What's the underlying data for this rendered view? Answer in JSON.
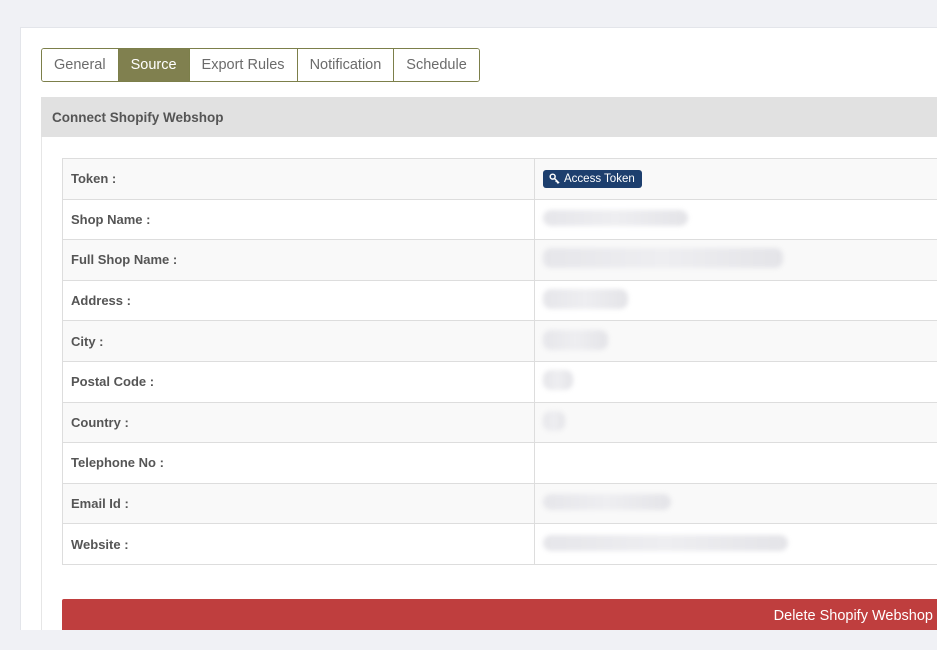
{
  "tabs": [
    {
      "label": "General",
      "active": false
    },
    {
      "label": "Source",
      "active": true
    },
    {
      "label": "Export Rules",
      "active": false
    },
    {
      "label": "Notification",
      "active": false
    },
    {
      "label": "Schedule",
      "active": false
    }
  ],
  "panel": {
    "title": "Connect Shopify Webshop"
  },
  "fields": [
    {
      "label": "Token :",
      "button": "Access Token"
    },
    {
      "label": "Shop Name :"
    },
    {
      "label": "Full Shop Name :"
    },
    {
      "label": "Address :"
    },
    {
      "label": "City :"
    },
    {
      "label": "Postal Code :"
    },
    {
      "label": "Country :"
    },
    {
      "label": "Telephone No :"
    },
    {
      "label": "Email Id :"
    },
    {
      "label": "Website :"
    }
  ],
  "delete_button": "Delete Shopify Webshop",
  "colors": {
    "tab_active": "#80804f",
    "token_button": "#1d3f6e",
    "delete_button": "#bf3e3e"
  }
}
